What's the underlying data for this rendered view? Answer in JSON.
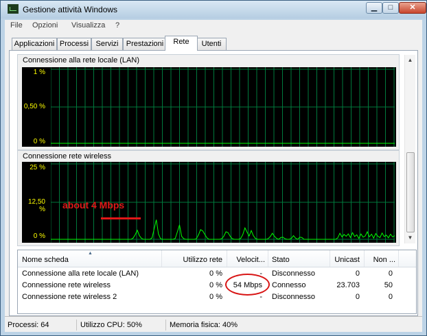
{
  "window": {
    "title": "Gestione attività Windows",
    "controls": {
      "minimize": "▁",
      "maximize": "□",
      "close": "✕"
    },
    "icon": "task-manager-icon"
  },
  "menu": [
    "File",
    "Opzioni",
    "Visualizza",
    "?"
  ],
  "tabs": [
    {
      "label": "Applicazioni",
      "active": false
    },
    {
      "label": "Processi",
      "active": false
    },
    {
      "label": "Servizi",
      "active": false
    },
    {
      "label": "Prestazioni",
      "active": false
    },
    {
      "label": "Rete",
      "active": true
    },
    {
      "label": "Utenti",
      "active": false
    }
  ],
  "graphs": [
    {
      "title": "Connessione alla rete locale (LAN)",
      "y_labels": [
        "1 %",
        "0,50 %",
        "0 %"
      ],
      "line_color": "#00ff00",
      "grid_color": "#007a3d",
      "samples": []
    },
    {
      "title": "Connessione rete wireless",
      "y_labels": [
        "25 %",
        "12,50 %",
        "0 %"
      ],
      "line_color": "#00ff00",
      "grid_color": "#007a3d",
      "samples": [
        0,
        0,
        0,
        0,
        0,
        0,
        0,
        0,
        0,
        0,
        0,
        0,
        0,
        0,
        0,
        0,
        0,
        0,
        0,
        0,
        0,
        0,
        0,
        0,
        0,
        0,
        0,
        0,
        0,
        0,
        0,
        0,
        0,
        0,
        0,
        0,
        0,
        0,
        0,
        0.4,
        1.5,
        3,
        1.2,
        0.3,
        0,
        0,
        0,
        0,
        0.5,
        3.5,
        6.5,
        1.8,
        0.2,
        0,
        0,
        0,
        0,
        0,
        0,
        0.3,
        2.5,
        4.8,
        1,
        0.2,
        0,
        0,
        0,
        0,
        0,
        0.2,
        1.5,
        3.2,
        2.8,
        1.6,
        0.5,
        0,
        0,
        0,
        0,
        0,
        0,
        0.2,
        1,
        2.5,
        2.2,
        1,
        0.2,
        0,
        0,
        0,
        0.3,
        1.6,
        3.8,
        2.4,
        1.1,
        2.9,
        1.2,
        0.3,
        0,
        0,
        0,
        0,
        0,
        0.2,
        0.9,
        2,
        1,
        0.3,
        0,
        0.6,
        0.7,
        0.2,
        0,
        0,
        0.3,
        1.2,
        0.4,
        0,
        0.7,
        0.6,
        0,
        0,
        0,
        0,
        0,
        0,
        0,
        0,
        0,
        0,
        0,
        0,
        0,
        0,
        0,
        0,
        0.5,
        2,
        0.8,
        1.6,
        1,
        1.8,
        0.6,
        2.2,
        0.9,
        1.5,
        0.3,
        1.8,
        0.7,
        1.1,
        2.5,
        0.8,
        1.7,
        0.4,
        1.9,
        1,
        0.6,
        2.1,
        0.9,
        1.4,
        0.5,
        1.7,
        0.8,
        1.2
      ]
    }
  ],
  "annotation": "about 4 Mbps",
  "annotation_color": "#e01818",
  "table": {
    "columns": [
      "Nome scheda",
      "Utilizzo rete",
      "Velocit...",
      "Stato",
      "Unicast",
      "Non ..."
    ],
    "rows": [
      {
        "name": "Connessione alla rete locale (LAN)",
        "usage": "0 %",
        "speed": "-",
        "state": "Disconnesso",
        "unicast": "0",
        "non_unicast": "0"
      },
      {
        "name": "Connessione rete wireless",
        "usage": "0 %",
        "speed": "54 Mbps",
        "state": "Connesso",
        "unicast": "23.703",
        "non_unicast": "50"
      },
      {
        "name": "Connessione rete wireless 2",
        "usage": "0 %",
        "speed": "-",
        "state": "Disconnesso",
        "unicast": "0",
        "non_unicast": "0"
      }
    ]
  },
  "status": {
    "processes": "Processi: 64",
    "cpu": "Utilizzo CPU: 50%",
    "memory": "Memoria fisica: 40%"
  }
}
